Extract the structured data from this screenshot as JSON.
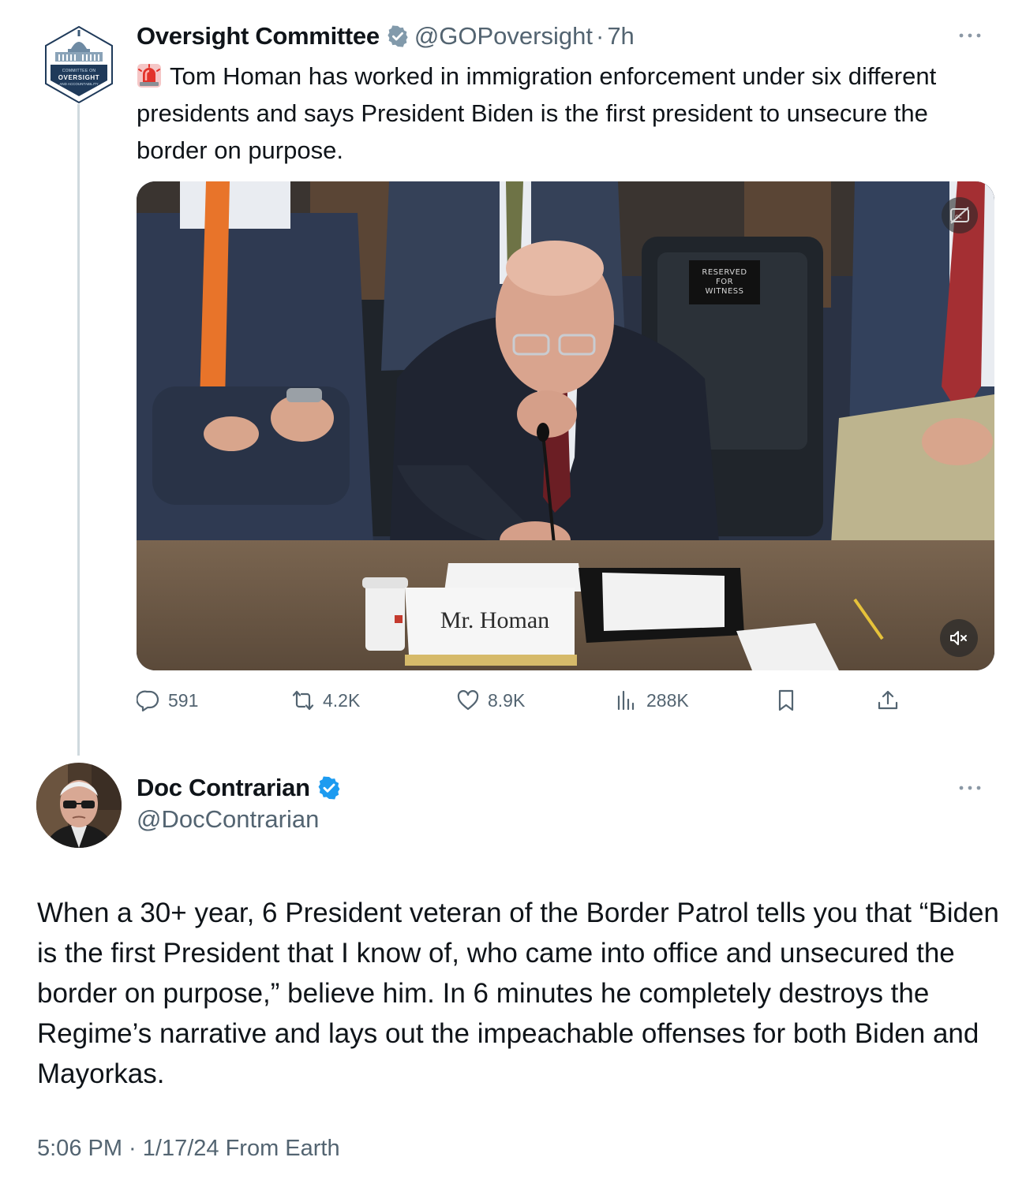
{
  "quoted_tweet": {
    "org_avatar": {
      "line1": "COMMITTEE ON",
      "line2": "OVERSIGHT",
      "line3": "AND ACCOUNTABILITY"
    },
    "display_name": "Oversight Committee",
    "handle": "@GOPoversight",
    "separator": "·",
    "time": "7h",
    "text": "Tom Homan has worked in immigration enforcement under six different presidents and says President Biden is the first president to unsecure the border on purpose.",
    "leading_icon": "siren-emoji-icon",
    "media": {
      "nameplate": "Mr. Homan",
      "sign_line1": "RESERVED",
      "sign_line2": "FOR",
      "sign_line3": "WITNESS",
      "icons": [
        "closed-captions-icon",
        "mute-icon"
      ]
    },
    "actions": {
      "replies": "591",
      "retweets": "4.2K",
      "likes": "8.9K",
      "views": "288K"
    }
  },
  "main_tweet": {
    "display_name": "Doc Contrarian",
    "handle": "@DocContrarian",
    "text": "When a 30+ year, 6 President veteran of the Border Patrol tells you that “Biden is the first President that I know of, who came into office and unsecured the border on purpose,” believe him. In 6 minutes he completely destroys the Regime’s narrative and lays out the impeachable offenses for both Biden and Mayorkas.",
    "meta": "5:06 PM · 1/17/24 From Earth"
  },
  "colors": {
    "text_primary": "#0f1419",
    "text_secondary": "#536471",
    "verified_blue": "#1d9bf0",
    "verified_gray": "#829aab",
    "thread_line": "#cfd9de"
  }
}
